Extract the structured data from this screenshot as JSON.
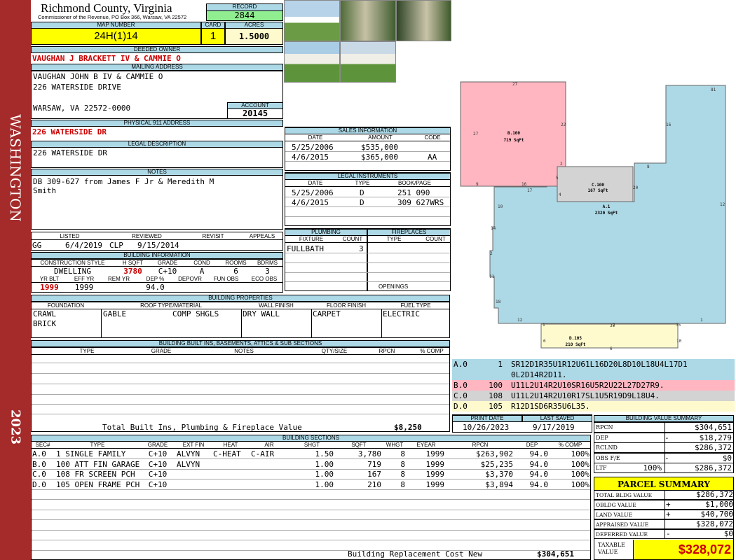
{
  "sidebar": {
    "name": "WASHINGTON",
    "year": "2023"
  },
  "header": {
    "county": "Richmond County, Virginia",
    "commissioner": "Commissioner of the Revenue, PO Box 366, Warsaw, VA 22572",
    "record_label": "RECORD",
    "record": "2844",
    "map_label": "MAP NUMBER",
    "map": "24H(1)14",
    "card_label": "CARD",
    "card": "1",
    "acres_label": "ACRES",
    "acres": "1.5000"
  },
  "owner": {
    "label": "DEEDED OWNER",
    "value": "VAUGHAN J BRACKETT IV & CAMMIE O"
  },
  "mailing": {
    "label": "MAILING ADDRESS",
    "line1": "VAUGHAN JOHN B IV & CAMMIE O",
    "line2": "226 WATERSIDE DRIVE",
    "line3": "WARSAW, VA 22572-0000",
    "account_label": "ACCOUNT",
    "account": "20145"
  },
  "physical": {
    "label": "PHYSICAL 911 ADDRESS",
    "value": "226 WATERSIDE DR"
  },
  "legal_desc": {
    "label": "LEGAL DESCRIPTION",
    "value": "226 WATERSIDE DR"
  },
  "notes": {
    "label": "NOTES",
    "line1": "DB 309-627 from James F Jr & Meredith M",
    "line2": "Smith"
  },
  "sales": {
    "label": "SALES INFORMATION",
    "headers": [
      "DATE",
      "AMOUNT",
      "CODE"
    ],
    "rows": [
      [
        "5/25/2006",
        "$535,000",
        ""
      ],
      [
        "4/6/2015",
        "$365,000",
        "AA"
      ]
    ]
  },
  "legal": {
    "label": "LEGAL INSTRUMENTS",
    "headers": [
      "DATE",
      "TYPE",
      "BOOK/PAGE"
    ],
    "rows": [
      [
        "5/25/2006",
        "D",
        "251 090"
      ],
      [
        "4/6/2015",
        "D",
        "309 627WRS"
      ]
    ]
  },
  "listed": {
    "headers": [
      "LISTED",
      "REVIEWED",
      "REVISIT",
      "APPEALS"
    ],
    "listed_by": "GG",
    "listed_date": "6/4/2019",
    "reviewed_by": "CLP",
    "reviewed_date": "9/15/2014"
  },
  "building": {
    "label": "BUILDING INFORMATION",
    "headers": [
      "CONSTRUCTION STYLE",
      "H SQFT",
      "GRADE",
      "COND",
      "ROOMS",
      "BDRMS"
    ],
    "style": "DWELLING",
    "hsqft": "3780",
    "grade": "C+10",
    "cond": "A",
    "rooms": "6",
    "bdrms": "3",
    "headers2": [
      "YR BLT",
      "EFF YR",
      "REM YR",
      "DEP %",
      "DEPOVR",
      "FUN OBS",
      "ECO OBS"
    ],
    "yrblt": "1999",
    "effyr": "1999",
    "dep": "94.0"
  },
  "plumbing": {
    "label": "PLUMBING",
    "headers": [
      "FIXTURE",
      "COUNT"
    ],
    "fixture": "FULLBATH",
    "count": "3"
  },
  "fireplaces": {
    "label": "FIREPLACES",
    "headers": [
      "TYPE",
      "COUNT"
    ],
    "openings": "OPENINGS"
  },
  "props": {
    "label": "BUILDING PROPERTIES",
    "headers": [
      "FOUNDATION",
      "ROOF TYPE/MATERIAL",
      "WALL FINISH",
      "FLOOR FINISH",
      "FUEL TYPE"
    ],
    "foundation1": "CRAWL",
    "foundation2": "BRICK",
    "roof_type": "GABLE",
    "roof_mat": "COMP SHGLS",
    "wall": "DRY WALL",
    "floor": "CARPET",
    "fuel": "ELECTRIC"
  },
  "builtins": {
    "label": "BUILDING BUILT INS, BASEMENTS, ATTICS & SUB SECTIONS",
    "headers": [
      "TYPE",
      "GRADE",
      "NOTES",
      "QTY/SIZE",
      "RPCN",
      "% COMP"
    ],
    "total_label": "Total Built Ins, Plumbing & Fireplace Value",
    "total": "$8,250"
  },
  "sections": {
    "label": "BUILDING SECTIONS",
    "headers": [
      "SEC#",
      "TYPE",
      "GRADE",
      "EXT FIN",
      "HEAT",
      "AIR",
      "SHGT",
      "SQFT",
      "WHGT",
      "EYEAR",
      "RPCN",
      "DEP",
      "% COMP"
    ],
    "rows": [
      [
        "A.0",
        "1 SINGLE FAMILY",
        "C+10",
        "ALVYN",
        "C-HEAT",
        "C-AIR",
        "1.50",
        "3,780",
        "8",
        "1999",
        "$263,902",
        "94.0",
        "100%"
      ],
      [
        "B.0",
        "100 ATT FIN GARAGE",
        "C+10",
        "ALVYN",
        "",
        "",
        "1.00",
        "719",
        "8",
        "1999",
        "$25,235",
        "94.0",
        "100%"
      ],
      [
        "C.0",
        "108 FR SCREEN PCH",
        "C+10",
        "",
        "",
        "",
        "1.00",
        "167",
        "8",
        "1999",
        "$3,370",
        "94.0",
        "100%"
      ],
      [
        "D.0",
        "105 OPEN FRAME PCH",
        "C+10",
        "",
        "",
        "",
        "1.00",
        "210",
        "8",
        "1999",
        "$3,894",
        "94.0",
        "100%"
      ]
    ],
    "total_label": "Building Replacement Cost New",
    "total": "$304,651"
  },
  "sketch": {
    "a_label": "A.1",
    "a_area": "2320 SqFt",
    "b_label": "B.100",
    "b_area": "719 SqFt",
    "c_label": "C.100",
    "c_area": "167 SqFt",
    "d_label": "D.105",
    "d_area": "210 SqFt",
    "dims": [
      "27",
      "22",
      "27",
      "9",
      "16",
      "2",
      "5",
      "4",
      "17",
      "10",
      "8",
      "20",
      "16",
      "81",
      "12",
      "12",
      "1",
      "1",
      "35",
      "35",
      "6",
      "6",
      "10",
      "2",
      "14",
      "2",
      "11",
      "18"
    ]
  },
  "vectors": [
    {
      "sec": "A.0",
      "code": "1",
      "text": "SR12D1R35U1R12U61L16D20L8D10L18U4L17D1",
      "text2": "0L2D14R2D11.",
      "color": "#add8e6"
    },
    {
      "sec": "B.0",
      "code": "100",
      "text": "U11L2U14R2U10SR16U5R2U22L27D27R9.",
      "color": "#ffb6c1"
    },
    {
      "sec": "C.0",
      "code": "108",
      "text": "U11L2U14R2U10R17SL1U5R19D9L18U4.",
      "color": "#d3d3d3"
    },
    {
      "sec": "D.0",
      "code": "105",
      "text": "R12D1SD6R35U6L35.",
      "color": "#fffacd"
    }
  ],
  "dates": {
    "print_label": "PRINT DATE",
    "print": "10/26/2023",
    "saved_label": "LAST SAVED",
    "saved": "9/17/2019"
  },
  "value_summary": {
    "label": "BUILDING VALUE SUMMARY",
    "rows": [
      [
        "RPCN",
        "",
        "$304,651"
      ],
      [
        "DEP",
        "-",
        "$18,279"
      ],
      [
        "RCLND",
        "",
        "$286,372"
      ],
      [
        "OBS F/E",
        "-",
        "$0"
      ],
      [
        "LTF",
        "100%",
        "$286,372"
      ]
    ]
  },
  "parcel": {
    "label": "PARCEL SUMMARY",
    "rows": [
      [
        "TOTAL BLDG VALUE",
        "",
        "$286,372"
      ],
      [
        "OBLDG VALUE",
        "+",
        "$1,000"
      ],
      [
        "LAND VALUE",
        "+",
        "$40,700"
      ],
      [
        "APPRAISED VALUE",
        "",
        "$328,072"
      ],
      [
        "DEFERRED VALUE",
        "-",
        "$0"
      ]
    ],
    "taxable_label1": "TAXABLE",
    "taxable_label2": "VALUE",
    "taxable": "$328,072"
  },
  "colors": {
    "sidebar": "#a52a2a",
    "header": "#add8e6",
    "record": "#90ee90",
    "yellow": "#ffff00",
    "pink": "#ffb6c1",
    "blue": "#add8e6",
    "gray": "#d3d3d3",
    "cream": "#fffacd"
  }
}
